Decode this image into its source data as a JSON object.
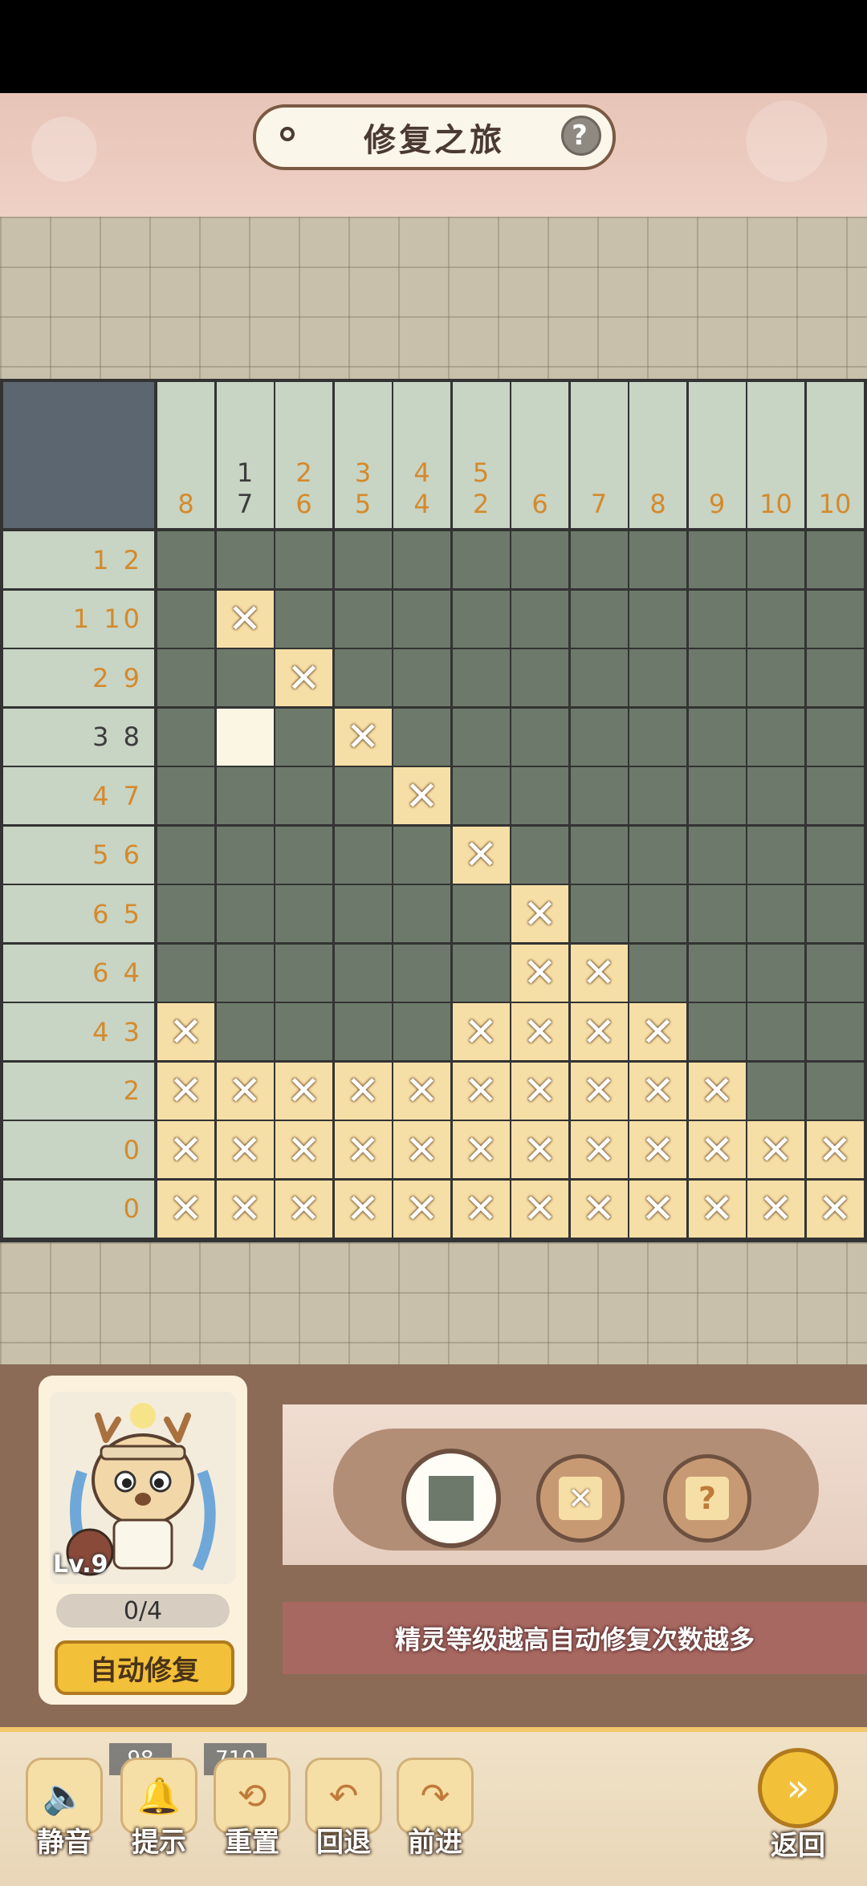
{
  "header": {
    "title": "修复之旅",
    "help_icon": "?"
  },
  "puzzle": {
    "column_clues": [
      [
        "8"
      ],
      [
        "1",
        "7"
      ],
      [
        "2",
        "6"
      ],
      [
        "3",
        "5"
      ],
      [
        "4",
        "4"
      ],
      [
        "5",
        "2"
      ],
      [
        "6"
      ],
      [
        "7"
      ],
      [
        "8"
      ],
      [
        "9"
      ],
      [
        "10"
      ],
      [
        "10"
      ]
    ],
    "column_done": [
      false,
      true,
      false,
      false,
      false,
      false,
      false,
      false,
      false,
      false,
      false,
      false
    ],
    "row_clues": [
      "1 2",
      "1 10",
      "2 9",
      "3 8",
      "4 7",
      "5 6",
      "6 5",
      "6 4",
      "4 3",
      "2",
      "0",
      "0"
    ],
    "row_done": [
      false,
      false,
      false,
      true,
      false,
      false,
      false,
      false,
      false,
      false,
      false,
      false
    ],
    "cells": [
      [
        0,
        0,
        0,
        0,
        0,
        0,
        0,
        0,
        0,
        0,
        0,
        0
      ],
      [
        0,
        2,
        0,
        0,
        0,
        0,
        0,
        0,
        0,
        0,
        0,
        0
      ],
      [
        0,
        0,
        2,
        0,
        0,
        0,
        0,
        0,
        0,
        0,
        0,
        0
      ],
      [
        0,
        1,
        0,
        2,
        0,
        0,
        0,
        0,
        0,
        0,
        0,
        0
      ],
      [
        0,
        0,
        0,
        0,
        2,
        0,
        0,
        0,
        0,
        0,
        0,
        0
      ],
      [
        0,
        0,
        0,
        0,
        0,
        2,
        0,
        0,
        0,
        0,
        0,
        0
      ],
      [
        0,
        0,
        0,
        0,
        0,
        0,
        2,
        0,
        0,
        0,
        0,
        0
      ],
      [
        0,
        0,
        0,
        0,
        0,
        0,
        2,
        2,
        0,
        0,
        0,
        0
      ],
      [
        2,
        0,
        0,
        0,
        0,
        2,
        2,
        2,
        2,
        0,
        0,
        0
      ],
      [
        2,
        2,
        2,
        2,
        2,
        2,
        2,
        2,
        2,
        2,
        0,
        0
      ],
      [
        2,
        2,
        2,
        2,
        2,
        2,
        2,
        2,
        2,
        2,
        2,
        2
      ],
      [
        2,
        2,
        2,
        2,
        2,
        2,
        2,
        2,
        2,
        2,
        2,
        2
      ]
    ],
    "colors": {
      "filled": "#6d7a6b",
      "marked": "#f6dfa6",
      "revealed": "#fbf6e3",
      "clue": "#d48a2c"
    }
  },
  "spirit": {
    "level": "Lv.9",
    "repairs": "0/4",
    "auto_repair_label": "自动修复"
  },
  "tools": {
    "fill": "fill-tool",
    "cross": "cross-tool",
    "hint": "?"
  },
  "tip": "精灵等级越高自动修复次数越多",
  "footer": {
    "mute_label": "静音",
    "hint_label": "提示",
    "hint_count": "98",
    "reset_label": "重置",
    "reset_count": "710",
    "undo_label": "回退",
    "redo_label": "前进",
    "back_label": "返回"
  }
}
